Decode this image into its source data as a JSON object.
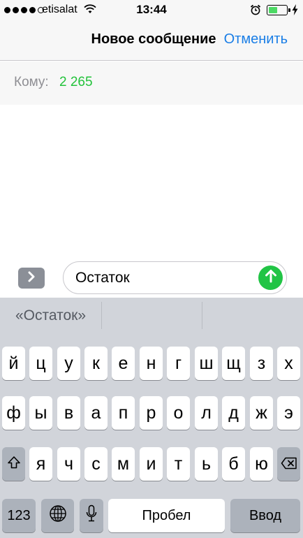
{
  "status_bar": {
    "carrier": "etisalat",
    "time": "13:44",
    "signal_bars_filled": 4,
    "signal_bars_total": 5,
    "battery_level": 0.5,
    "icons": [
      "wifi-icon",
      "alarm-icon",
      "battery-icon",
      "charging-bolt-icon"
    ]
  },
  "nav": {
    "title": "Новое сообщение",
    "cancel_label": "Отменить"
  },
  "recipient": {
    "label": "Кому:",
    "value": "2 265"
  },
  "compose": {
    "message_text": "Остаток",
    "expand_icon": "chevron-right-icon",
    "send_icon": "arrow-up-icon"
  },
  "keyboard": {
    "suggestions": [
      "«Остаток»",
      "",
      ""
    ],
    "row1": [
      "й",
      "ц",
      "у",
      "к",
      "е",
      "н",
      "г",
      "ш",
      "щ",
      "з",
      "х"
    ],
    "row2": [
      "ф",
      "ы",
      "в",
      "а",
      "п",
      "р",
      "о",
      "л",
      "д",
      "ж",
      "э"
    ],
    "row3": [
      "я",
      "ч",
      "с",
      "м",
      "и",
      "т",
      "ь",
      "б",
      "ю"
    ],
    "numbers_label": "123",
    "space_label": "Пробел",
    "return_label": "Ввод",
    "icons": [
      "shift-icon",
      "backspace-icon",
      "globe-icon",
      "microphone-icon"
    ]
  },
  "colors": {
    "accent_blue": "#1a7ee6",
    "recipient_green": "#22c23a",
    "send_green": "#21c445",
    "keyboard_bg": "#d1d4da",
    "function_key": "#acb2bb"
  }
}
